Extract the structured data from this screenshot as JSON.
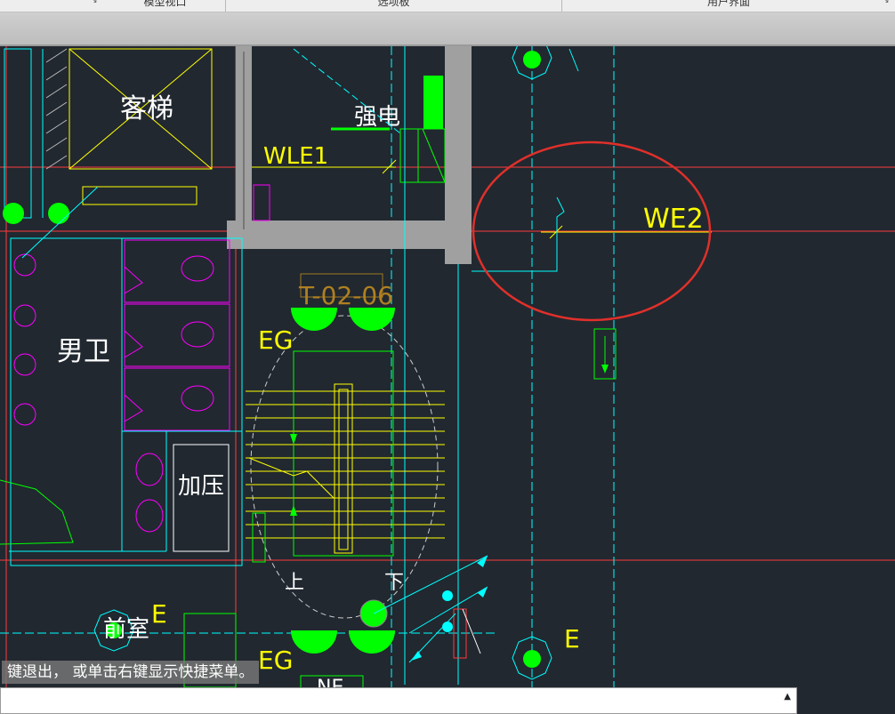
{
  "ribbon": {
    "panels": [
      {
        "label": "模型视口"
      },
      {
        "label": "选项板"
      },
      {
        "label": "用户界面"
      }
    ]
  },
  "drawing": {
    "labels": {
      "elevator": "客梯",
      "strong_current": "强电",
      "wle1": "WLE1",
      "we2": "WE2",
      "tag": "T-02-06",
      "eg_top": "EG",
      "eg_bottom": "EG",
      "men_toilet": "男卫",
      "pressurize": "加压",
      "up": "上",
      "down": "下",
      "front_room": "前室",
      "e_left": "E",
      "e_right": "E",
      "ne": "NE"
    },
    "colors": {
      "background": "#212830",
      "yellow": "#ffff00",
      "cyan": "#00ffff",
      "magenta": "#ff00ff",
      "green": "#00ff00",
      "red_axis": "#ff3b3b",
      "markup_circle": "#e0302a",
      "wall_gray": "#a0a0a0"
    }
  },
  "command": {
    "history_text": "键退出， 或单击右键显示快捷菜单。",
    "input_value": ""
  }
}
